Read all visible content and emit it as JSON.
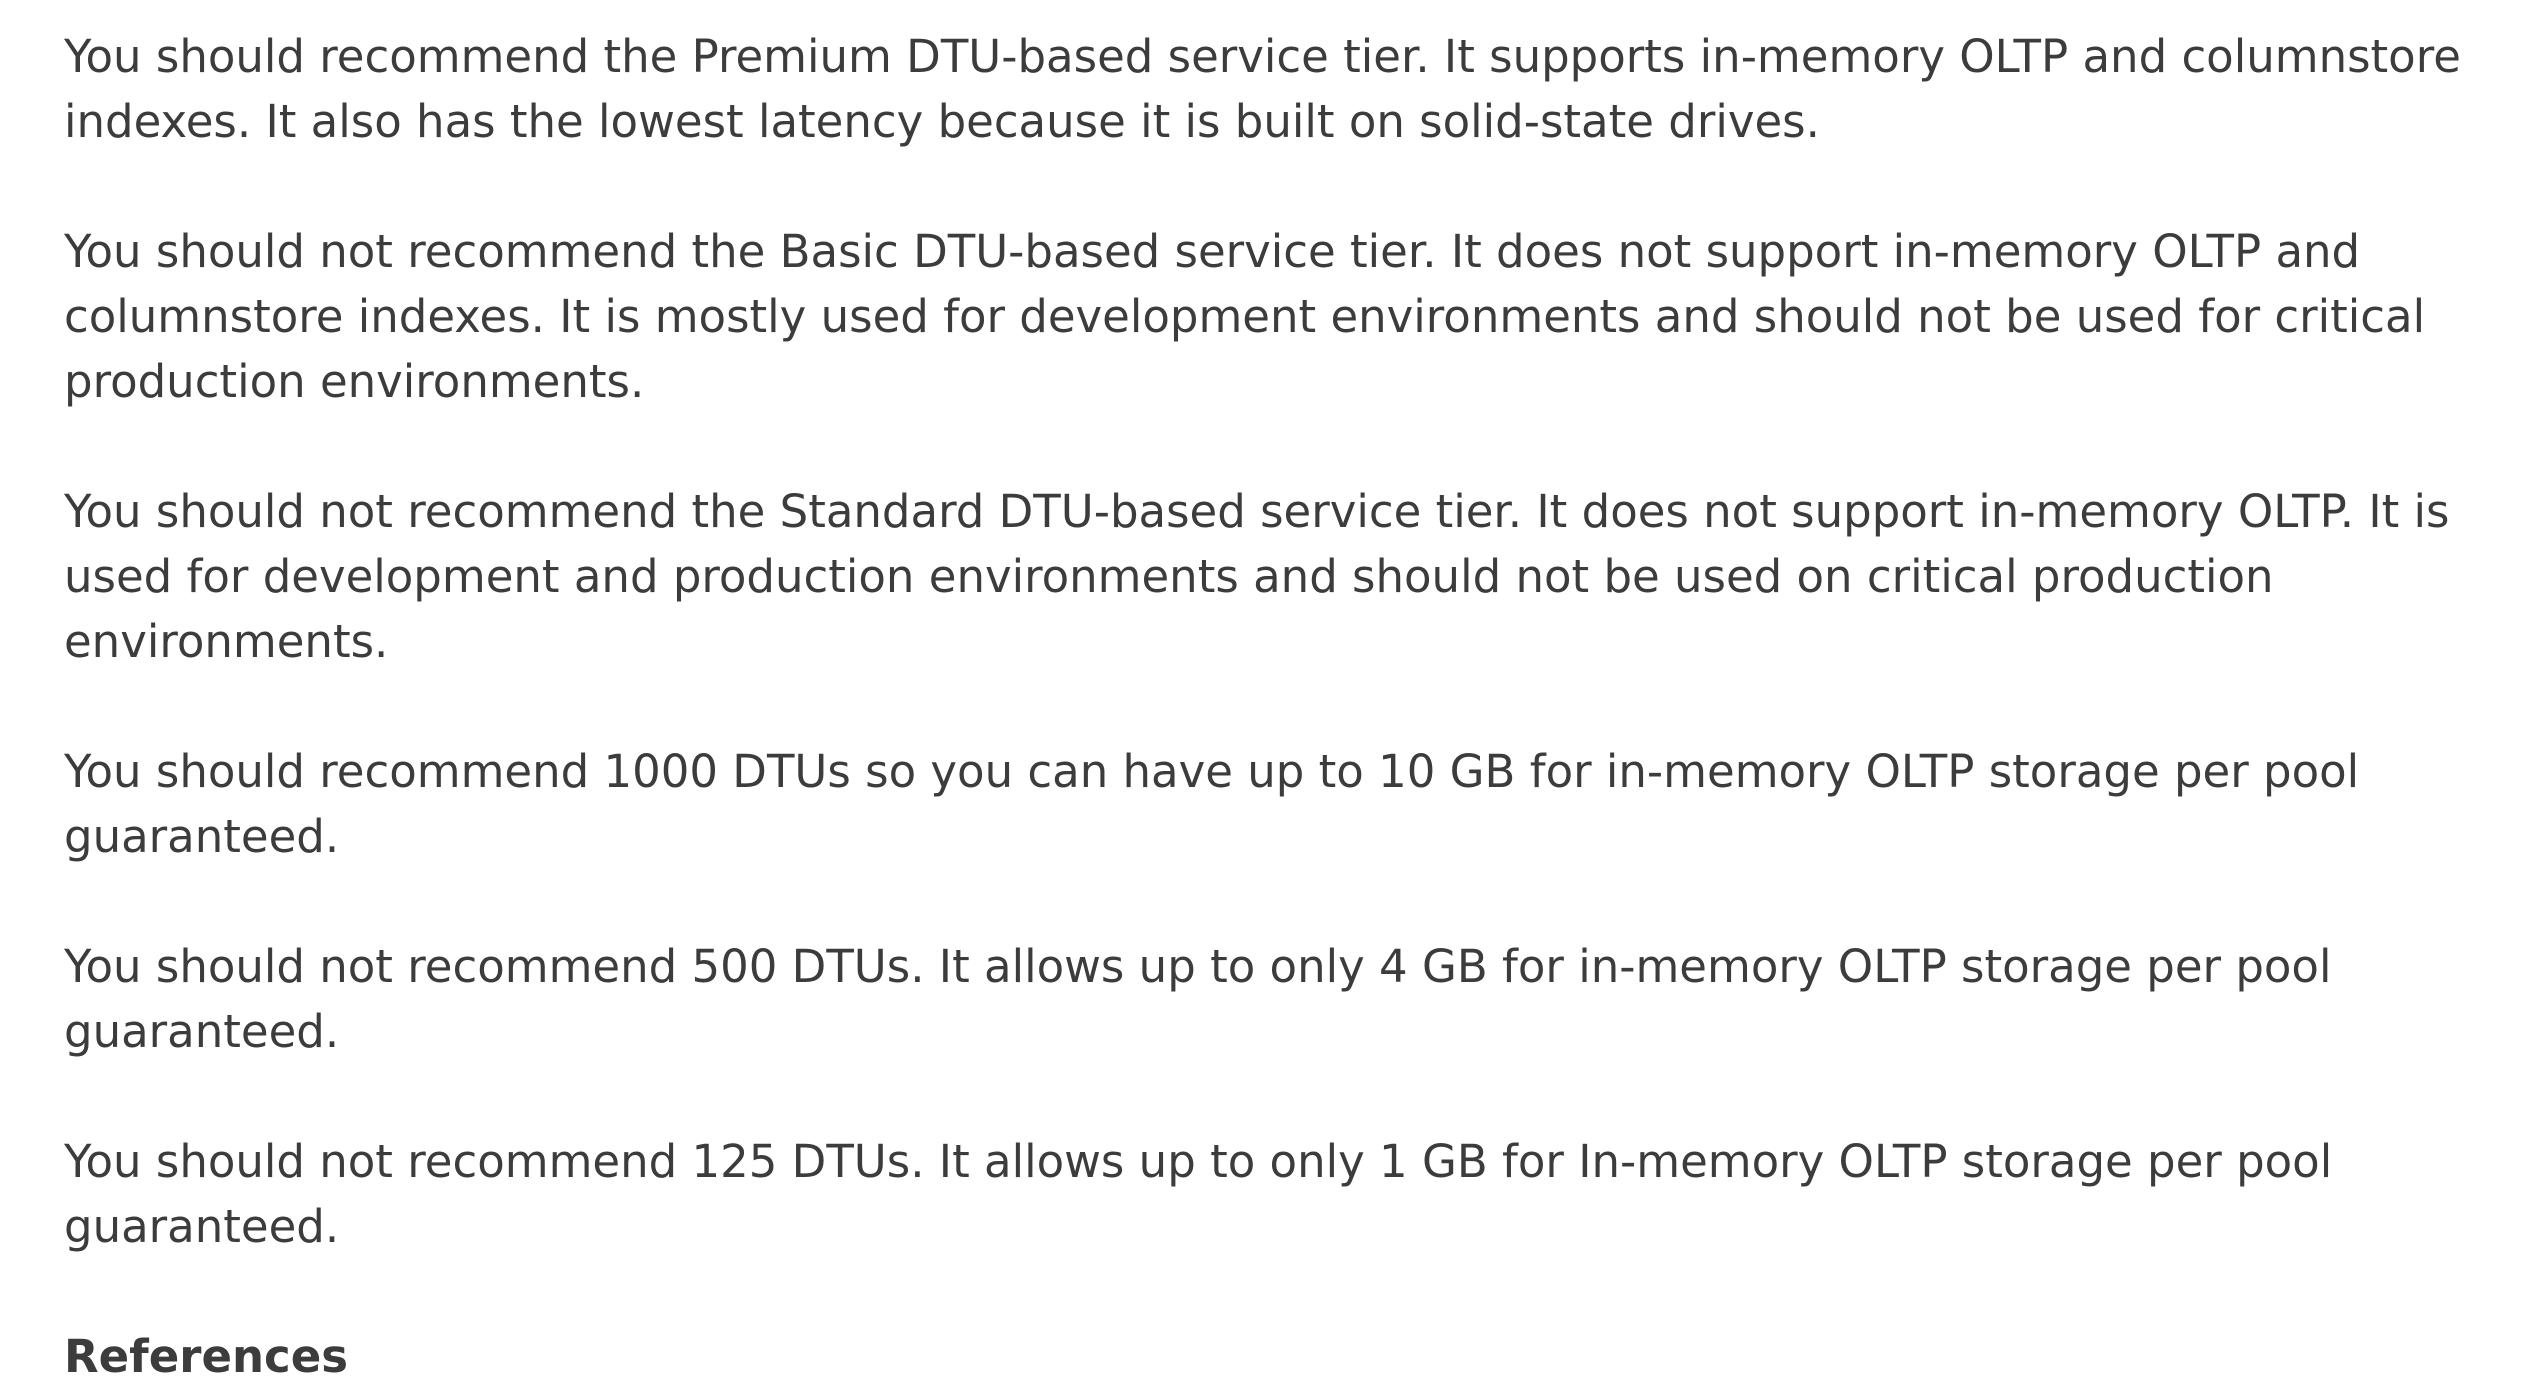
{
  "explanation": {
    "paragraphs": [
      "You should recommend the Premium DTU-based service tier. It supports in-memory OLTP and columnstore indexes. It also has the lowest latency because it is built on solid-state drives.",
      "You should not recommend the Basic DTU-based service tier. It does not support in-memory OLTP and columnstore indexes. It is mostly used for development environments and should not be used for critical production environments.",
      "You should not recommend the Standard DTU-based service tier. It does not support in-memory OLTP. It is used for development and production environments and should not be used on critical production environments.",
      "You should recommend 1000 DTUs so you can have up to 10 GB for in-memory OLTP storage per pool guaranteed.",
      "You should not recommend 500 DTUs. It allows up to only 4 GB for in-memory OLTP storage per pool guaranteed.",
      "You should not recommend 125 DTUs. It allows up to only 1 GB for In-memory OLTP storage per pool guaranteed."
    ],
    "references_heading": "References"
  }
}
